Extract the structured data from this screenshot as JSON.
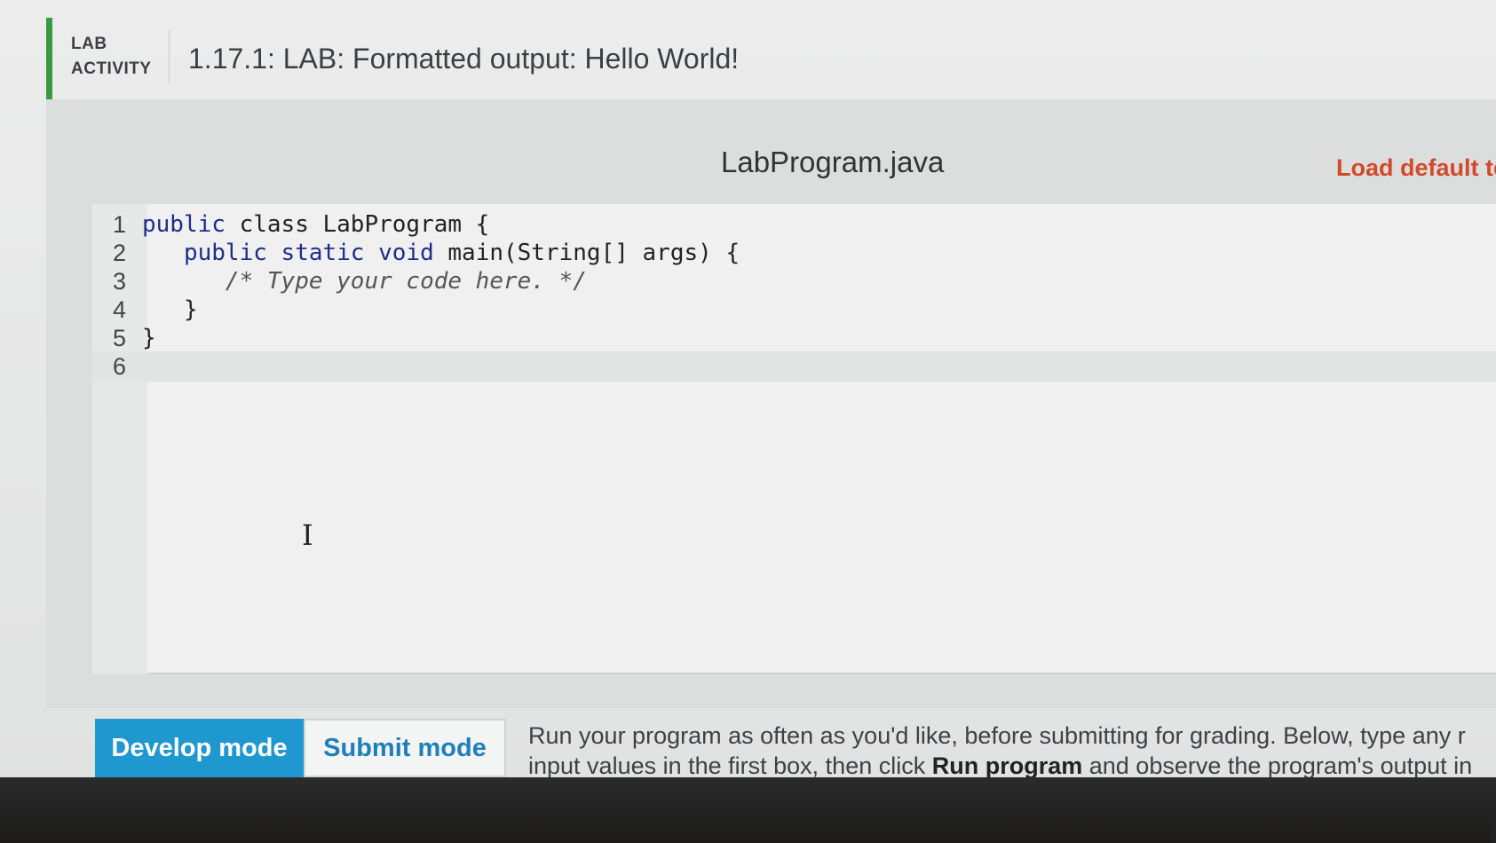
{
  "header": {
    "kind_line1": "LAB",
    "kind_line2": "ACTIVITY",
    "title": "1.17.1: LAB: Formatted output: Hello World!",
    "accent_color": "#3a9a3f"
  },
  "editor": {
    "file_name": "LabProgram.java",
    "load_default_label": "Load default te",
    "lines": [
      {
        "num": "1",
        "parts": [
          [
            "kw",
            "public"
          ],
          [
            "",
            "class LabProgram {"
          ]
        ]
      },
      {
        "num": "2",
        "parts": [
          [
            "",
            "   "
          ],
          [
            "kw",
            "public static void"
          ],
          [
            "",
            "main(String[] args) {"
          ]
        ]
      },
      {
        "num": "3",
        "parts": [
          [
            "",
            "      "
          ],
          [
            "cmt",
            "/* Type your code here. */"
          ]
        ]
      },
      {
        "num": "4",
        "parts": [
          [
            "",
            "   }"
          ]
        ]
      },
      {
        "num": "5",
        "parts": [
          [
            "",
            "}"
          ]
        ]
      },
      {
        "num": "6",
        "parts": [
          [
            "",
            ""
          ]
        ]
      }
    ],
    "active_line": 6
  },
  "modes": {
    "develop_label": "Develop mode",
    "submit_label": "Submit mode",
    "selected": "develop",
    "develop_color": "#1f97cf"
  },
  "help": {
    "line1": "Run your program as often as you'd like, before submitting for grading. Below, type any r",
    "line2_before": "input values in the first box, then click ",
    "line2_bold": "Run program",
    "line2_after": " and observe the program's output in"
  },
  "colors": {
    "load_default": "#d24a2b"
  }
}
